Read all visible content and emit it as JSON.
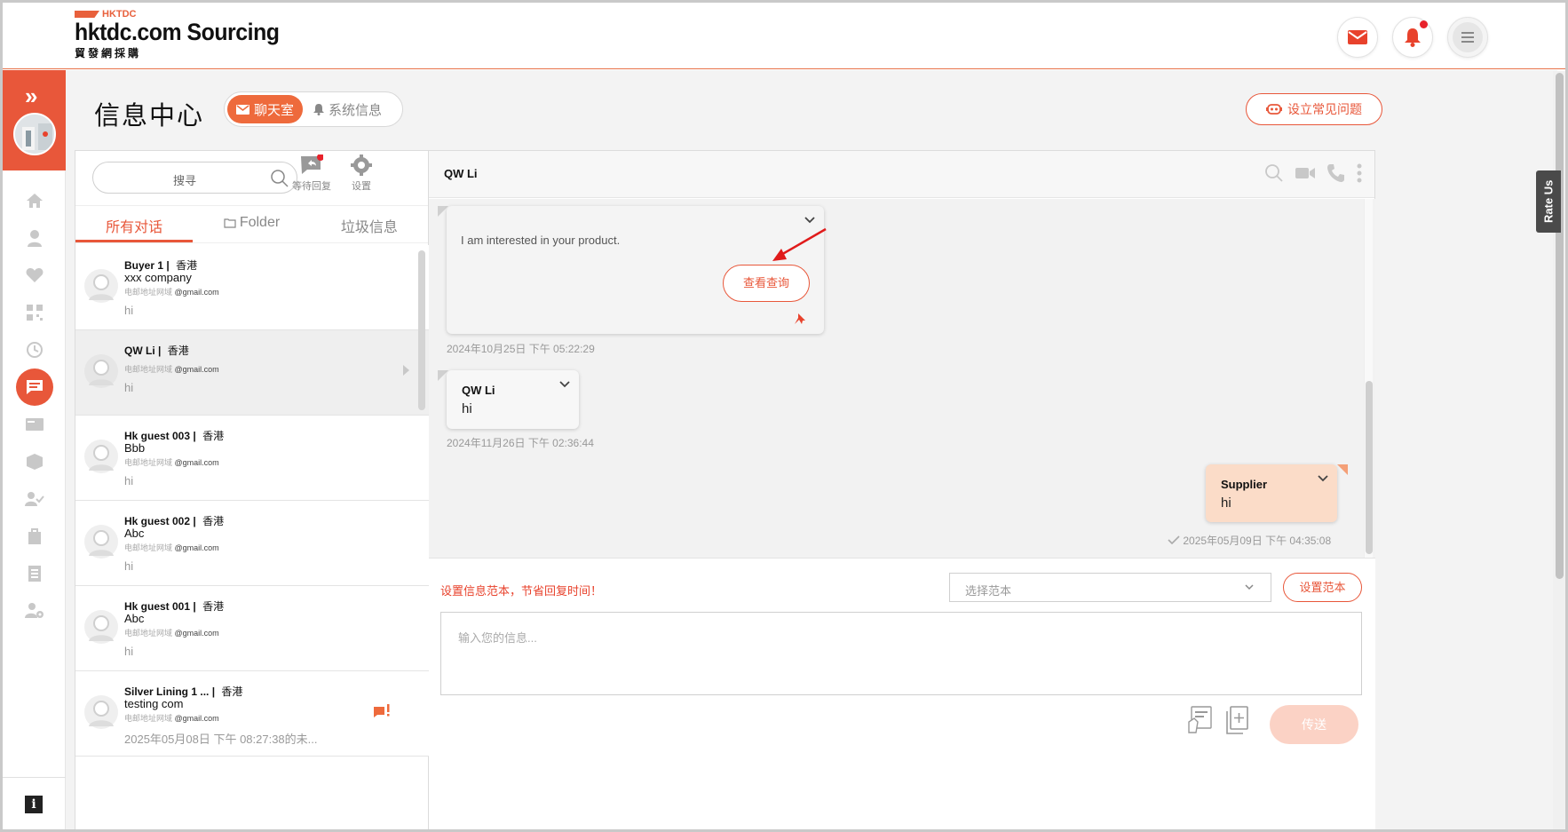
{
  "header": {
    "brand_small": "HKTDC",
    "brand_main": "hktdc.com Sourcing",
    "brand_sub": "貿發網採購"
  },
  "page": {
    "title": "信息中心",
    "tabs": [
      {
        "label": "聊天室",
        "active": true
      },
      {
        "label": "系统信息",
        "active": false
      }
    ],
    "faq_button": "设立常见问题",
    "rate_us": "Rate Us"
  },
  "list": {
    "search_placeholder": "搜寻",
    "tools": [
      {
        "label": "等待回复",
        "icon": "pending-reply-icon"
      },
      {
        "label": "设置",
        "icon": "gear-icon"
      }
    ],
    "tabs": [
      {
        "label": "所有对话",
        "active": true
      },
      {
        "label": "Folder",
        "active": false
      },
      {
        "label": "垃圾信息",
        "active": false
      }
    ],
    "email_label": "电邮地址网域",
    "conversations": [
      {
        "name": "Buyer 1",
        "location": "香港",
        "company": "xxx company",
        "email": "@gmail.com",
        "last": "hi"
      },
      {
        "name": "QW Li",
        "location": "香港",
        "company": "",
        "email": "@gmail.com",
        "last": "hi"
      },
      {
        "name": "Hk guest 003",
        "location": "香港",
        "company": "Bbb",
        "email": "@gmail.com",
        "last": "hi"
      },
      {
        "name": "Hk guest 002",
        "location": "香港",
        "company": "Abc",
        "email": "@gmail.com",
        "last": "hi"
      },
      {
        "name": "Hk guest 001",
        "location": "香港",
        "company": "Abc",
        "email": "@gmail.com",
        "last": "hi"
      },
      {
        "name": "Silver Lining 1 ...",
        "location": "香港",
        "company": "testing com",
        "email": "@gmail.com",
        "last": "2025年05月08日 下午 08:27:38的未..."
      }
    ]
  },
  "chat": {
    "contact": "QW Li",
    "messages": [
      {
        "text": "I am interested in your product.",
        "button": "查看查询",
        "time": "2024年10月25日 下午 05:22:29"
      },
      {
        "sender": "QW Li",
        "text": "hi",
        "time": "2024年11月26日 下午 02:36:44"
      },
      {
        "sender": "Supplier",
        "text": "hi",
        "time": "2025年05月09日 下午 04:35:08"
      }
    ],
    "template_hint": "设置信息范本，节省回复时间！",
    "template_placeholder": "选择范本",
    "template_button": "设置范本",
    "input_placeholder": "输入您的信息...",
    "send_button": "传送"
  },
  "colors": {
    "accent": "#e8573a",
    "send_disabled": "#fbd2c5",
    "supplier_bubble": "#fbdcc8",
    "notification_dot": "#e8222b"
  }
}
